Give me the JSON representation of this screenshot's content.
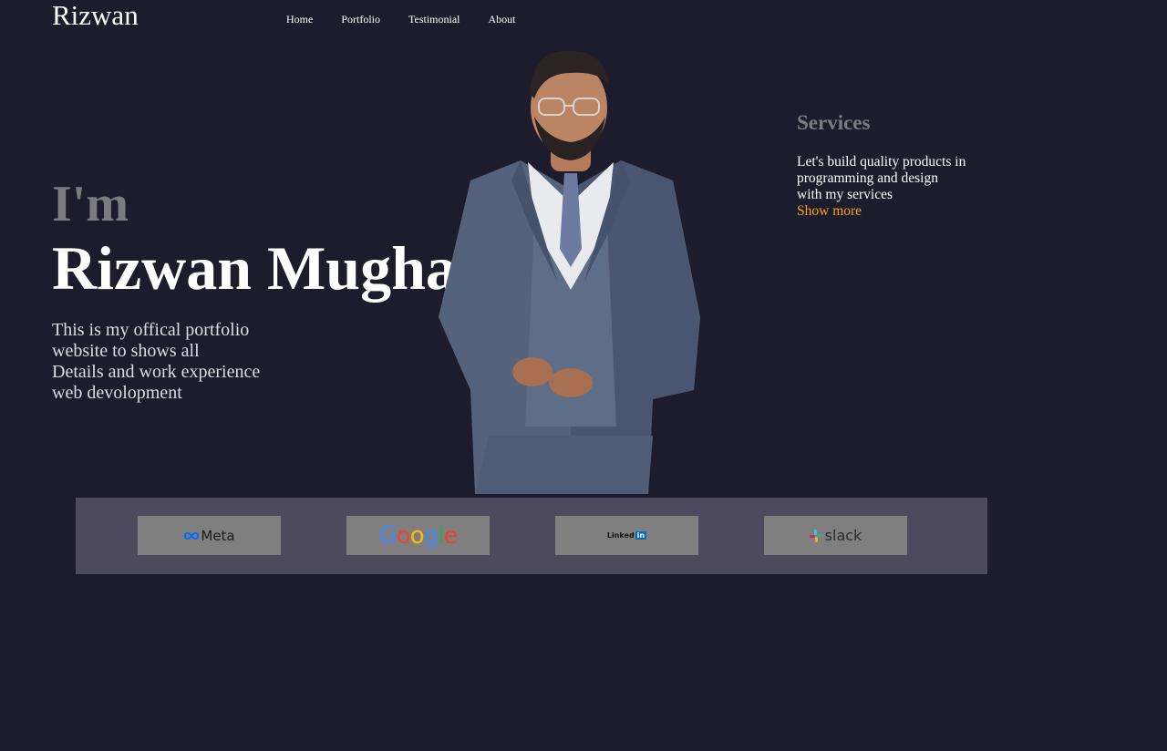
{
  "header": {
    "brand": "Rizwan",
    "nav": [
      "Home",
      "Portfolio",
      "Testimonial",
      "About"
    ]
  },
  "hero": {
    "intro": "I'm",
    "name": "Rizwan Mughal",
    "bio_lines": [
      "This is my offical portfolio",
      "website to shows all",
      "Details and work experience",
      "web devolopment"
    ]
  },
  "services": {
    "title": "Services",
    "lines": [
      "Let's build quality products in",
      "programming and design",
      "with my services"
    ],
    "link": "Show more"
  },
  "brands": {
    "meta": "Meta",
    "google": [
      "G",
      "o",
      "o",
      "g",
      "l",
      "e"
    ],
    "linkedin": "Linked",
    "linkedin_in": "in",
    "slack": "slack"
  },
  "colors": {
    "background": "#1d1c2c",
    "accent": "#f5a623",
    "muted": "#7c7b82",
    "strip": "#4c4a5c",
    "tile": "#807f80"
  }
}
